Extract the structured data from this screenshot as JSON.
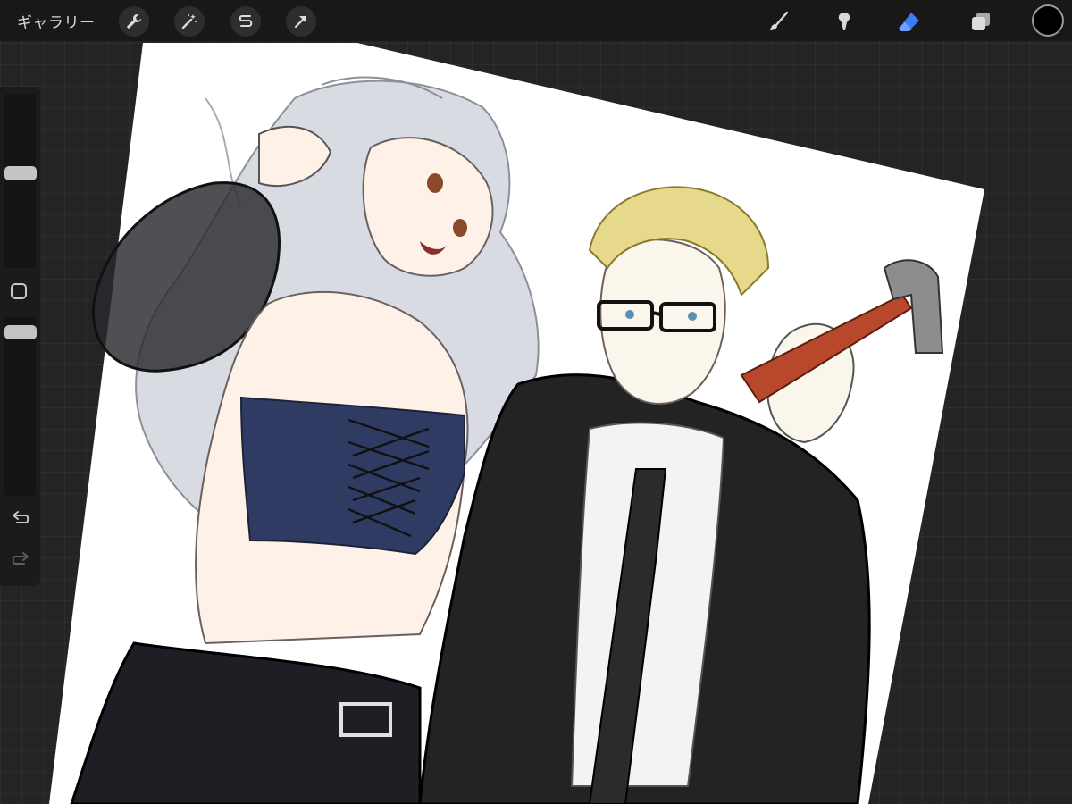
{
  "toolbar": {
    "gallery_label": "ギャラリー",
    "left_tools": [
      {
        "icon": "wrench-icon"
      },
      {
        "icon": "magic-wand-icon"
      },
      {
        "icon": "selection-icon"
      },
      {
        "icon": "transform-arrow-icon"
      }
    ],
    "right_tools": [
      {
        "icon": "brush-icon"
      },
      {
        "icon": "smudge-icon"
      },
      {
        "icon": "eraser-icon",
        "active": true
      },
      {
        "icon": "layers-icon"
      }
    ],
    "active_color": "#000000",
    "accent_color": "#3d7bf0"
  },
  "sidebar": {
    "brush_size_level": 0.55,
    "opacity_level": 0.95,
    "controls": [
      "modify-button",
      "undo",
      "redo"
    ]
  }
}
